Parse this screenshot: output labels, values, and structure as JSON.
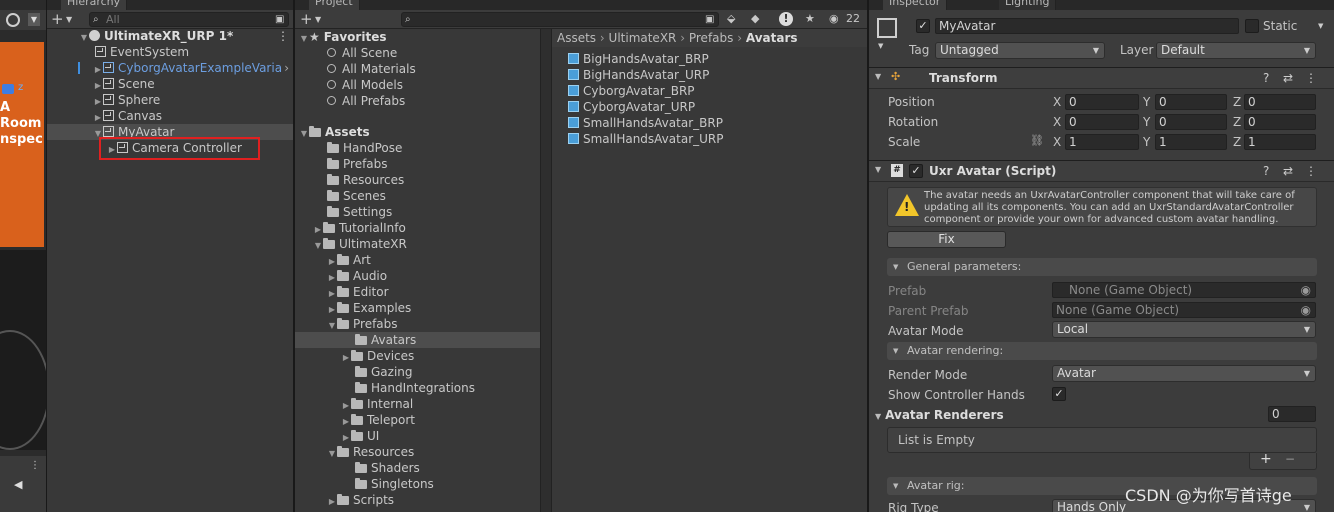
{
  "tabs": {
    "hierarchy": "Hierarchy",
    "project": "Project",
    "inspector": "Inspector",
    "lighting": "Lighting"
  },
  "hierarchy": {
    "search_placeholder": "All",
    "scene": "UltimateXR_URP 1*",
    "items": [
      "EventSystem",
      "CyborgAvatarExampleVaria",
      "Scene",
      "Sphere",
      "Canvas",
      "MyAvatar",
      "Camera Controller"
    ]
  },
  "scene_view": {
    "text_a": "A",
    "text_room": "Room",
    "text_inspect": "nspec",
    "axis_z": "z"
  },
  "project": {
    "favorites_label": "Favorites",
    "favorites": [
      "All Scene",
      "All Materials",
      "All Models",
      "All Prefabs"
    ],
    "assets_label": "Assets",
    "tree": [
      "HandPose",
      "Prefabs",
      "Resources",
      "Scenes",
      "Settings",
      "TutorialInfo",
      "UltimateXR",
      "Art",
      "Audio",
      "Editor",
      "Examples",
      "Prefabs",
      "Avatars",
      "Devices",
      "Gazing",
      "HandIntegrations",
      "Internal",
      "Teleport",
      "UI",
      "Resources",
      "Shaders",
      "Singletons",
      "Scripts"
    ],
    "breadcrumb": [
      "Assets",
      "UltimateXR",
      "Prefabs",
      "Avatars"
    ],
    "files": [
      "BigHandsAvatar_BRP",
      "BigHandsAvatar_URP",
      "CyborgAvatar_BRP",
      "CyborgAvatar_URP",
      "SmallHandsAvatar_BRP",
      "SmallHandsAvatar_URP"
    ],
    "hidden_count": "22"
  },
  "inspector": {
    "name": "MyAvatar",
    "static_label": "Static",
    "tag_label": "Tag",
    "tag_value": "Untagged",
    "layer_label": "Layer",
    "layer_value": "Default",
    "transform": {
      "title": "Transform",
      "position_label": "Position",
      "rotation_label": "Rotation",
      "scale_label": "Scale",
      "x": "X",
      "y": "Y",
      "z": "Z",
      "position": [
        "0",
        "0",
        "0"
      ],
      "rotation": [
        "0",
        "0",
        "0"
      ],
      "scale": [
        "1",
        "1",
        "1"
      ]
    },
    "component": {
      "title": "Uxr Avatar (Script)",
      "warning": "The avatar needs an UxrAvatarController component that will take care of updating all its components. You can add an UxrStandardAvatarController component or provide your own for advanced custom avatar handling.",
      "fix_label": "Fix",
      "general": "General parameters:",
      "prefab_label": "Prefab",
      "prefab_value": "None (Game Object)",
      "parent_prefab_label": "Parent Prefab",
      "parent_prefab_value": "None (Game Object)",
      "avatar_mode_label": "Avatar Mode",
      "avatar_mode_value": "Local",
      "rendering": "Avatar rendering:",
      "render_mode_label": "Render Mode",
      "render_mode_value": "Avatar",
      "show_hands_label": "Show Controller Hands",
      "renderers_label": "Avatar Renderers",
      "renderers_count": "0",
      "list_empty": "List is Empty",
      "rig": "Avatar rig:",
      "rig_type_label": "Rig Type",
      "rig_type_value": "Hands Only"
    }
  },
  "watermark": "CSDN @为你写首诗ge"
}
